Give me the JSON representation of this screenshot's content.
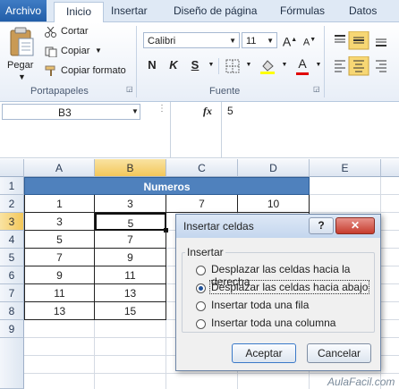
{
  "tabs": [
    "Archivo",
    "Inicio",
    "Insertar",
    "Diseño de página",
    "Fórmulas",
    "Datos"
  ],
  "clipboard": {
    "paste": "Pegar",
    "cut": "Cortar",
    "copy": "Copiar",
    "format_painter": "Copiar formato",
    "group": "Portapapeles"
  },
  "font": {
    "name": "Calibri",
    "size": "11",
    "group": "Fuente",
    "bold": "N",
    "italic": "K",
    "underline": "S"
  },
  "formula_bar": {
    "name_box": "B3",
    "fx": "fx",
    "value": "5"
  },
  "columns": [
    "A",
    "B",
    "C",
    "D",
    "E"
  ],
  "rows": [
    "1",
    "2",
    "3",
    "4",
    "5",
    "6",
    "7",
    "8",
    "9"
  ],
  "table": {
    "title": "Numeros",
    "colA": [
      "1",
      "3",
      "5",
      "7",
      "9",
      "11",
      "13"
    ],
    "colB": [
      "3",
      "5",
      "7",
      "9",
      "11",
      "13",
      "15"
    ],
    "colC2": "7",
    "colD2": "10"
  },
  "dialog": {
    "title": "Insertar celdas",
    "help": "?",
    "close": "✕",
    "group": "Insertar",
    "options": [
      "Desplazar las celdas hacia la derecha",
      "Desplazar las celdas hacia abajo",
      "Insertar toda una fila",
      "Insertar toda una columna"
    ],
    "selected_option_index": 1,
    "ok": "Aceptar",
    "cancel": "Cancelar"
  },
  "watermark": "AulaFacil.com",
  "colors": {
    "accent": "#1f5aa8",
    "table_header": "#4f81bd",
    "selected_header": "#f3c75a"
  }
}
